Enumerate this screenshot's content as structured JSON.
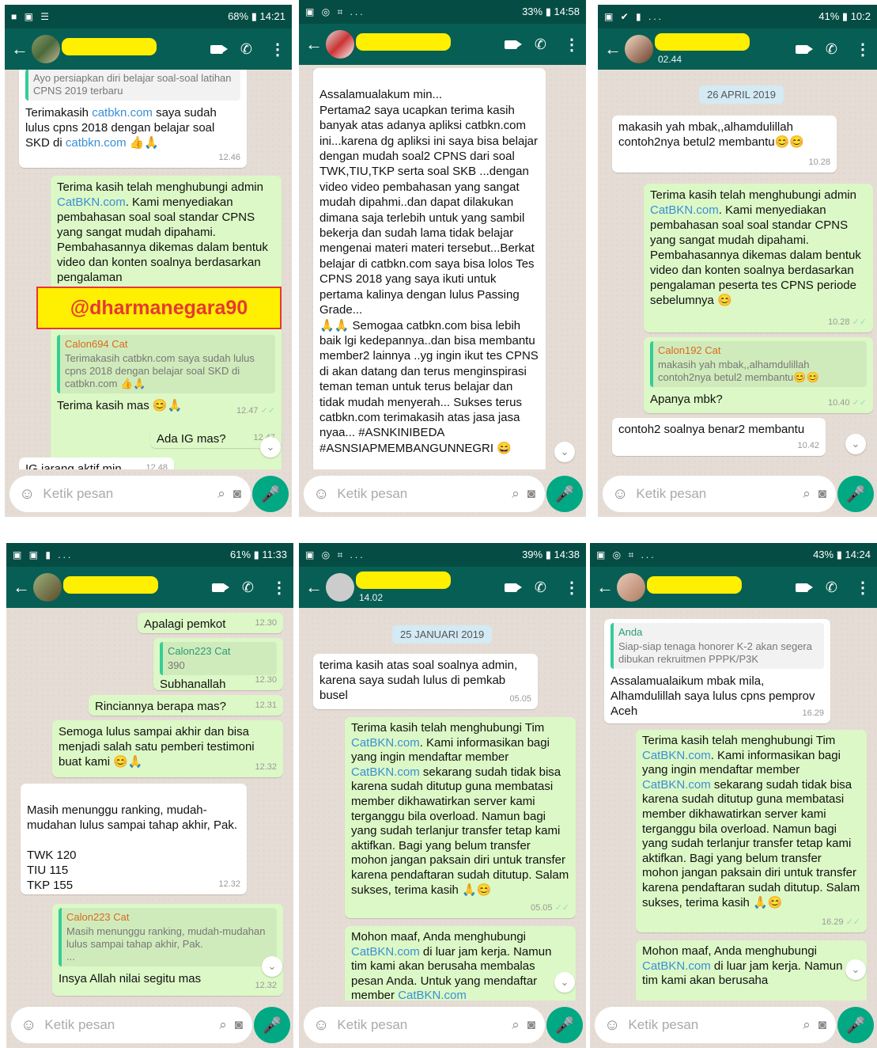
{
  "p1": {
    "status": {
      "left": "■ ▣ ☰",
      "right": "68% ▮ 14:21"
    },
    "quote_top": "Ayo persiapkan diri belajar soal-soal latihan CPNS 2019 terbaru",
    "m1": {
      "a": "Terimakasih ",
      "link": "catbkn.com",
      "b": " saya sudah lulus cpns 2018 dengan belajar soal SKD di ",
      "link2": "catbkn.com",
      "c": " 👍🙏",
      "time": "12.46"
    },
    "m2": {
      "a": "Terima kasih telah menghubungi admin ",
      "link": "CatBKN.com",
      "b": ". Kami menyediakan pembahasan soal soal standar CPNS yang sangat mudah dipahami. Pembahasannya dikemas dalam bentuk video dan konten soalnya berdasarkan pengalaman"
    },
    "watermark": "@dharmanegara90",
    "m3": {
      "qname": "Calon694 Cat",
      "qtext": "Terimakasih catbkn.com saya sudah lulus cpns 2018 dengan belajar soal SKD di catbkn.com 👍🙏",
      "text": "Terima kasih mas 😊🙏",
      "time": "12.47"
    },
    "m4": {
      "text": "Ada IG mas?",
      "time": "12.47"
    },
    "m5": {
      "text": "IG jarang aktif min.",
      "time": "12.48"
    },
    "input": "Ketik pesan"
  },
  "p2": {
    "status": {
      "left": "▣ ◎ ⌗ ...",
      "right": "33% ▮ 14:58"
    },
    "body": "Assalamualakum min...\nPertama2 saya ucapkan terima kasih banyak atas adanya apliksi catbkn.com ini...karena dg apliksi ini saya bisa belajar dengan mudah soal2 CPNS dari soal TWK,TIU,TKP serta soal SKB ...dengan video video pembahasan yang sangat mudah dipahmi..dan dapat dilakukan dimana saja terlebih untuk yang sambil bekerja dan sudah lama tidak belajar mengenai materi materi tersebut...Berkat belajar di catbkn.com saya bisa lolos Tes CPNS 2018 yang saya ikuti untuk pertama kalinya dengan lulus Passing Grade...\n🙏🙏 Semogaa catbkn.com bisa lebih baik lgi kedepannya..dan bisa membantu member2 lainnya ..yg ingin ikut tes CPNS di akan datang dan terus menginspirasi teman teman untuk terus belajar dan tidak mudah menyerah... Sukses terus catbkn.com terimakasih atas jasa jasa nyaa... #ASNKINIBEDA #ASNSIAPMEMBANGUNNEGRI 😄",
    "input": "Ketik pesan"
  },
  "p3": {
    "status": {
      "left": "▣ ✔ ▮ ...",
      "right": "41% ▮ 10:2"
    },
    "sub": "02.44",
    "date": "26 APRIL 2019",
    "m1": {
      "text": "makasih yah mbak,,alhamdulillah contoh2nya betul2 membantu😊😊",
      "time": "10.28"
    },
    "m2": {
      "a": "Terima kasih telah menghubungi admin ",
      "link": "CatBKN.com",
      "b": ". Kami menyediakan pembahasan soal soal standar CPNS yang sangat mudah dipahami. Pembahasannya dikemas dalam bentuk video dan konten soalnya berdasarkan pengalaman peserta tes CPNS periode sebelumnya 😊",
      "time": "10.28"
    },
    "m3": {
      "qname": "Calon192 Cat",
      "qtext": "makasih yah mbak,,alhamdulillah contoh2nya betul2 membantu😊😊",
      "text": "Apanya mbk?",
      "time": "10.40"
    },
    "m4": {
      "text": "contoh2 soalnya benar2 membantu",
      "time": "10.42"
    },
    "input": "Ketik pesan"
  },
  "p4": {
    "status": {
      "left": "▣ ▣ ▮ ...",
      "right": "61% ▮ 11:33"
    },
    "m1": {
      "text": "Apalagi pemkot",
      "time": "12.30"
    },
    "m2": {
      "qname": "Calon223 Cat",
      "qtext": "390",
      "text": "Subhanallah",
      "time": "12.30"
    },
    "m3": {
      "text": "Rinciannya berapa mas?",
      "time": "12.31"
    },
    "m4": {
      "text": "Semoga lulus sampai akhir dan bisa menjadi salah satu pemberi testimoni buat kami 😊🙏",
      "time": "12.32"
    },
    "m5": {
      "text": "Masih menunggu ranking, mudah-mudahan lulus sampai tahap akhir, Pak.\n\nTWK 120\nTIU 115\nTKP 155",
      "time": "12.32"
    },
    "m6": {
      "qname": "Calon223 Cat",
      "qtext": "Masih menunggu ranking, mudah-mudahan lulus sampai tahap akhir, Pak.\n...",
      "text": "Insya Allah nilai segitu mas",
      "time": "12.32"
    },
    "input": "Ketik pesan"
  },
  "p5": {
    "status": {
      "left": "▣ ◎ ⌗ ...",
      "right": "39% ▮ 14:38"
    },
    "sub": "14.02",
    "date": "25 JANUARI 2019",
    "m1": {
      "text": "terima kasih atas soal soalnya admin, karena saya sudah lulus di pemkab busel",
      "time": "05.05"
    },
    "m2": {
      "a": "Terima kasih telah menghubungi Tim ",
      "link": "CatBKN.com",
      "b": ". Kami informasikan bagi yang ingin mendaftar member ",
      "link2": "CatBKN.com",
      "c": " sekarang sudah tidak bisa karena sudah ditutup guna membatasi member dikhawatirkan server kami terganggu bila overload. Namun bagi yang sudah terlanjur transfer tetap kami aktifkan. Bagi yang belum transfer mohon jangan paksain diri untuk transfer karena pendaftaran sudah ditutup. Salam sukses, terima kasih 🙏😊",
      "time": "05.05"
    },
    "m3": {
      "a": "Mohon maaf, Anda menghubungi ",
      "link": "CatBKN.com",
      "b": " di luar jam kerja. Namun tim kami akan berusaha membalas pesan Anda. Untuk yang mendaftar member ",
      "link2": "CatBKN.com"
    },
    "input": "Ketik pesan"
  },
  "p6": {
    "status": {
      "left": "▣ ◎ ⌗ ...",
      "right": "43% ▮ 14:24"
    },
    "m1": {
      "qname": "Anda",
      "qtext": "Siap-siap tenaga honorer K-2 akan segera dibukan rekruitmen PPPK/P3K",
      "text": "Assalamualaikum mbak mila, Alhamdulillah saya lulus cpns pemprov Aceh",
      "time": "16.29"
    },
    "m2": {
      "a": "Terima kasih telah menghubungi Tim ",
      "link": "CatBKN.com",
      "b": ". Kami informasikan bagi yang ingin mendaftar member ",
      "link2": "CatBKN.com",
      "c": " sekarang sudah tidak bisa karena sudah ditutup guna membatasi member dikhawatirkan server kami terganggu bila overload. Namun bagi yang sudah terlanjur transfer tetap kami aktifkan. Bagi yang belum transfer mohon jangan paksain diri untuk transfer karena pendaftaran sudah ditutup. Salam sukses, terima kasih 🙏😊",
      "time": "16.29"
    },
    "m3": {
      "a": "Mohon maaf, Anda menghubungi ",
      "link": "CatBKN.com",
      "b": " di luar jam kerja. Namun tim kami akan berusaha"
    },
    "input": "Ketik pesan"
  },
  "icons": {
    "back": "←",
    "more": "⋮",
    "call": "✆",
    "smiley": "☺",
    "clip": "⌕",
    "camera": "◙",
    "mic": "🎤",
    "down": "⌄",
    "check": "✓✓"
  }
}
